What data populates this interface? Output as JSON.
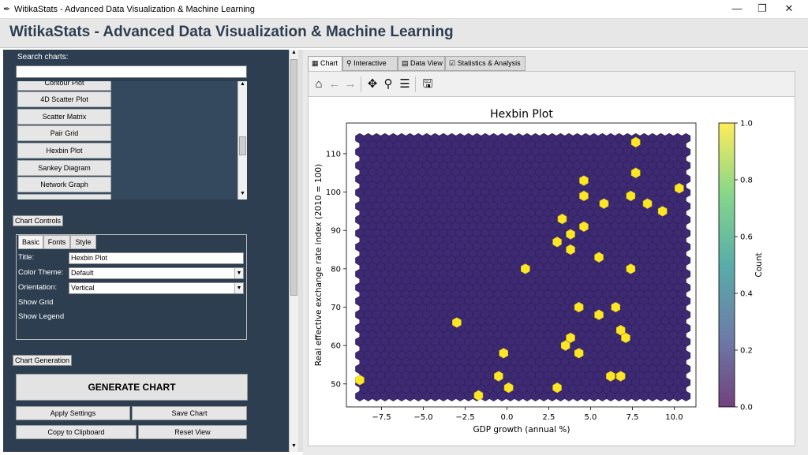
{
  "window": {
    "title": "WitikaStats - Advanced Data Visualization & Machine Learning",
    "minimize_glyph": "—",
    "maximize_glyph": "❐",
    "close_glyph": "✕"
  },
  "header": {
    "title": "WitikaStats - Advanced Data Visualization & Machine Learning"
  },
  "sidebar": {
    "search_label": "Search charts:",
    "search_value": "",
    "chart_list": [
      "Contour Plot",
      "4D Scatter Plot",
      "Scatter Matrix",
      "Pair Grid",
      "Hexbin Plot",
      "Sankey Diagram",
      "Network Graph"
    ],
    "chart_controls_label": "Chart Controls",
    "control_tabs": [
      "Basic",
      "Fonts",
      "Style"
    ],
    "title_label": "Title:",
    "title_value": "Hexbin Plot",
    "color_theme_label": "Color Theme:",
    "color_theme_value": "Default",
    "orientation_label": "Orientation:",
    "orientation_value": "Vertical",
    "show_grid_label": "Show Grid",
    "show_legend_label": "Show Legend",
    "chart_generation_label": "Chart Generation",
    "generate_label": "GENERATE CHART",
    "apply_label": "Apply Settings",
    "save_label": "Save Chart",
    "copy_label": "Copy to Clipboard",
    "reset_label": "Reset View"
  },
  "main": {
    "tabs": [
      "Chart",
      "Interactive",
      "Data View",
      "Statistics & Analysis"
    ],
    "active_tab": "Chart"
  },
  "colors": {
    "panel": "#2c3e50",
    "low": "#3d2a73",
    "high": "#fde725"
  },
  "chart_data": {
    "type": "heatmap",
    "title": "Hexbin Plot",
    "xlabel": "GDP growth (annual %)",
    "ylabel": "Real effective exchange rate index (2010 = 100)",
    "colorbar_label": "Count",
    "xlim": [
      -9.6,
      11.3
    ],
    "ylim": [
      44,
      118
    ],
    "x_ticks": [
      -7.5,
      -5.0,
      -2.5,
      0.0,
      2.5,
      5.0,
      7.5,
      10.0
    ],
    "x_tick_labels": [
      "−7.5",
      "−5.0",
      "−2.5",
      "0.0",
      "2.5",
      "5.0",
      "7.5",
      "10.0"
    ],
    "y_ticks": [
      50,
      60,
      70,
      80,
      90,
      100,
      110
    ],
    "y_tick_labels": [
      "50",
      "60",
      "70",
      "80",
      "90",
      "100",
      "110"
    ],
    "colorbar_ticks": [
      "0.0",
      "0.2",
      "0.4",
      "0.6",
      "0.8",
      "1.0"
    ],
    "grid": true,
    "hex_x_range": [
      -8.8,
      10.8
    ],
    "hex_y_range": [
      46,
      114
    ],
    "filled_bins": [
      {
        "x": 7.7,
        "y": 113,
        "count": 1
      },
      {
        "x": 7.7,
        "y": 105,
        "count": 1
      },
      {
        "x": 4.6,
        "y": 103,
        "count": 1
      },
      {
        "x": 4.6,
        "y": 99,
        "count": 1
      },
      {
        "x": 5.8,
        "y": 97,
        "count": 1
      },
      {
        "x": 7.4,
        "y": 99,
        "count": 1
      },
      {
        "x": 8.4,
        "y": 97,
        "count": 1
      },
      {
        "x": 10.3,
        "y": 101,
        "count": 1
      },
      {
        "x": 9.3,
        "y": 95,
        "count": 1
      },
      {
        "x": 3.3,
        "y": 93,
        "count": 1
      },
      {
        "x": 4.6,
        "y": 91,
        "count": 1
      },
      {
        "x": 3.8,
        "y": 89,
        "count": 1
      },
      {
        "x": 3.0,
        "y": 87,
        "count": 1
      },
      {
        "x": 3.8,
        "y": 85,
        "count": 1
      },
      {
        "x": 5.5,
        "y": 83,
        "count": 1
      },
      {
        "x": 1.1,
        "y": 80,
        "count": 1
      },
      {
        "x": 7.4,
        "y": 80,
        "count": 1
      },
      {
        "x": 4.3,
        "y": 70,
        "count": 1
      },
      {
        "x": 6.5,
        "y": 70,
        "count": 1
      },
      {
        "x": 5.5,
        "y": 68,
        "count": 1
      },
      {
        "x": -3.0,
        "y": 66,
        "count": 1
      },
      {
        "x": 6.8,
        "y": 64,
        "count": 1
      },
      {
        "x": 7.1,
        "y": 62,
        "count": 1
      },
      {
        "x": 3.8,
        "y": 62,
        "count": 1
      },
      {
        "x": 3.5,
        "y": 60,
        "count": 1
      },
      {
        "x": -0.2,
        "y": 58,
        "count": 1
      },
      {
        "x": 4.3,
        "y": 58,
        "count": 1
      },
      {
        "x": -0.5,
        "y": 52,
        "count": 1
      },
      {
        "x": 6.2,
        "y": 52,
        "count": 1
      },
      {
        "x": 6.8,
        "y": 52,
        "count": 1
      },
      {
        "x": -8.8,
        "y": 51,
        "count": 1
      },
      {
        "x": 0.1,
        "y": 49,
        "count": 1
      },
      {
        "x": 3.0,
        "y": 49,
        "count": 1
      },
      {
        "x": -1.7,
        "y": 47,
        "count": 1
      }
    ]
  }
}
